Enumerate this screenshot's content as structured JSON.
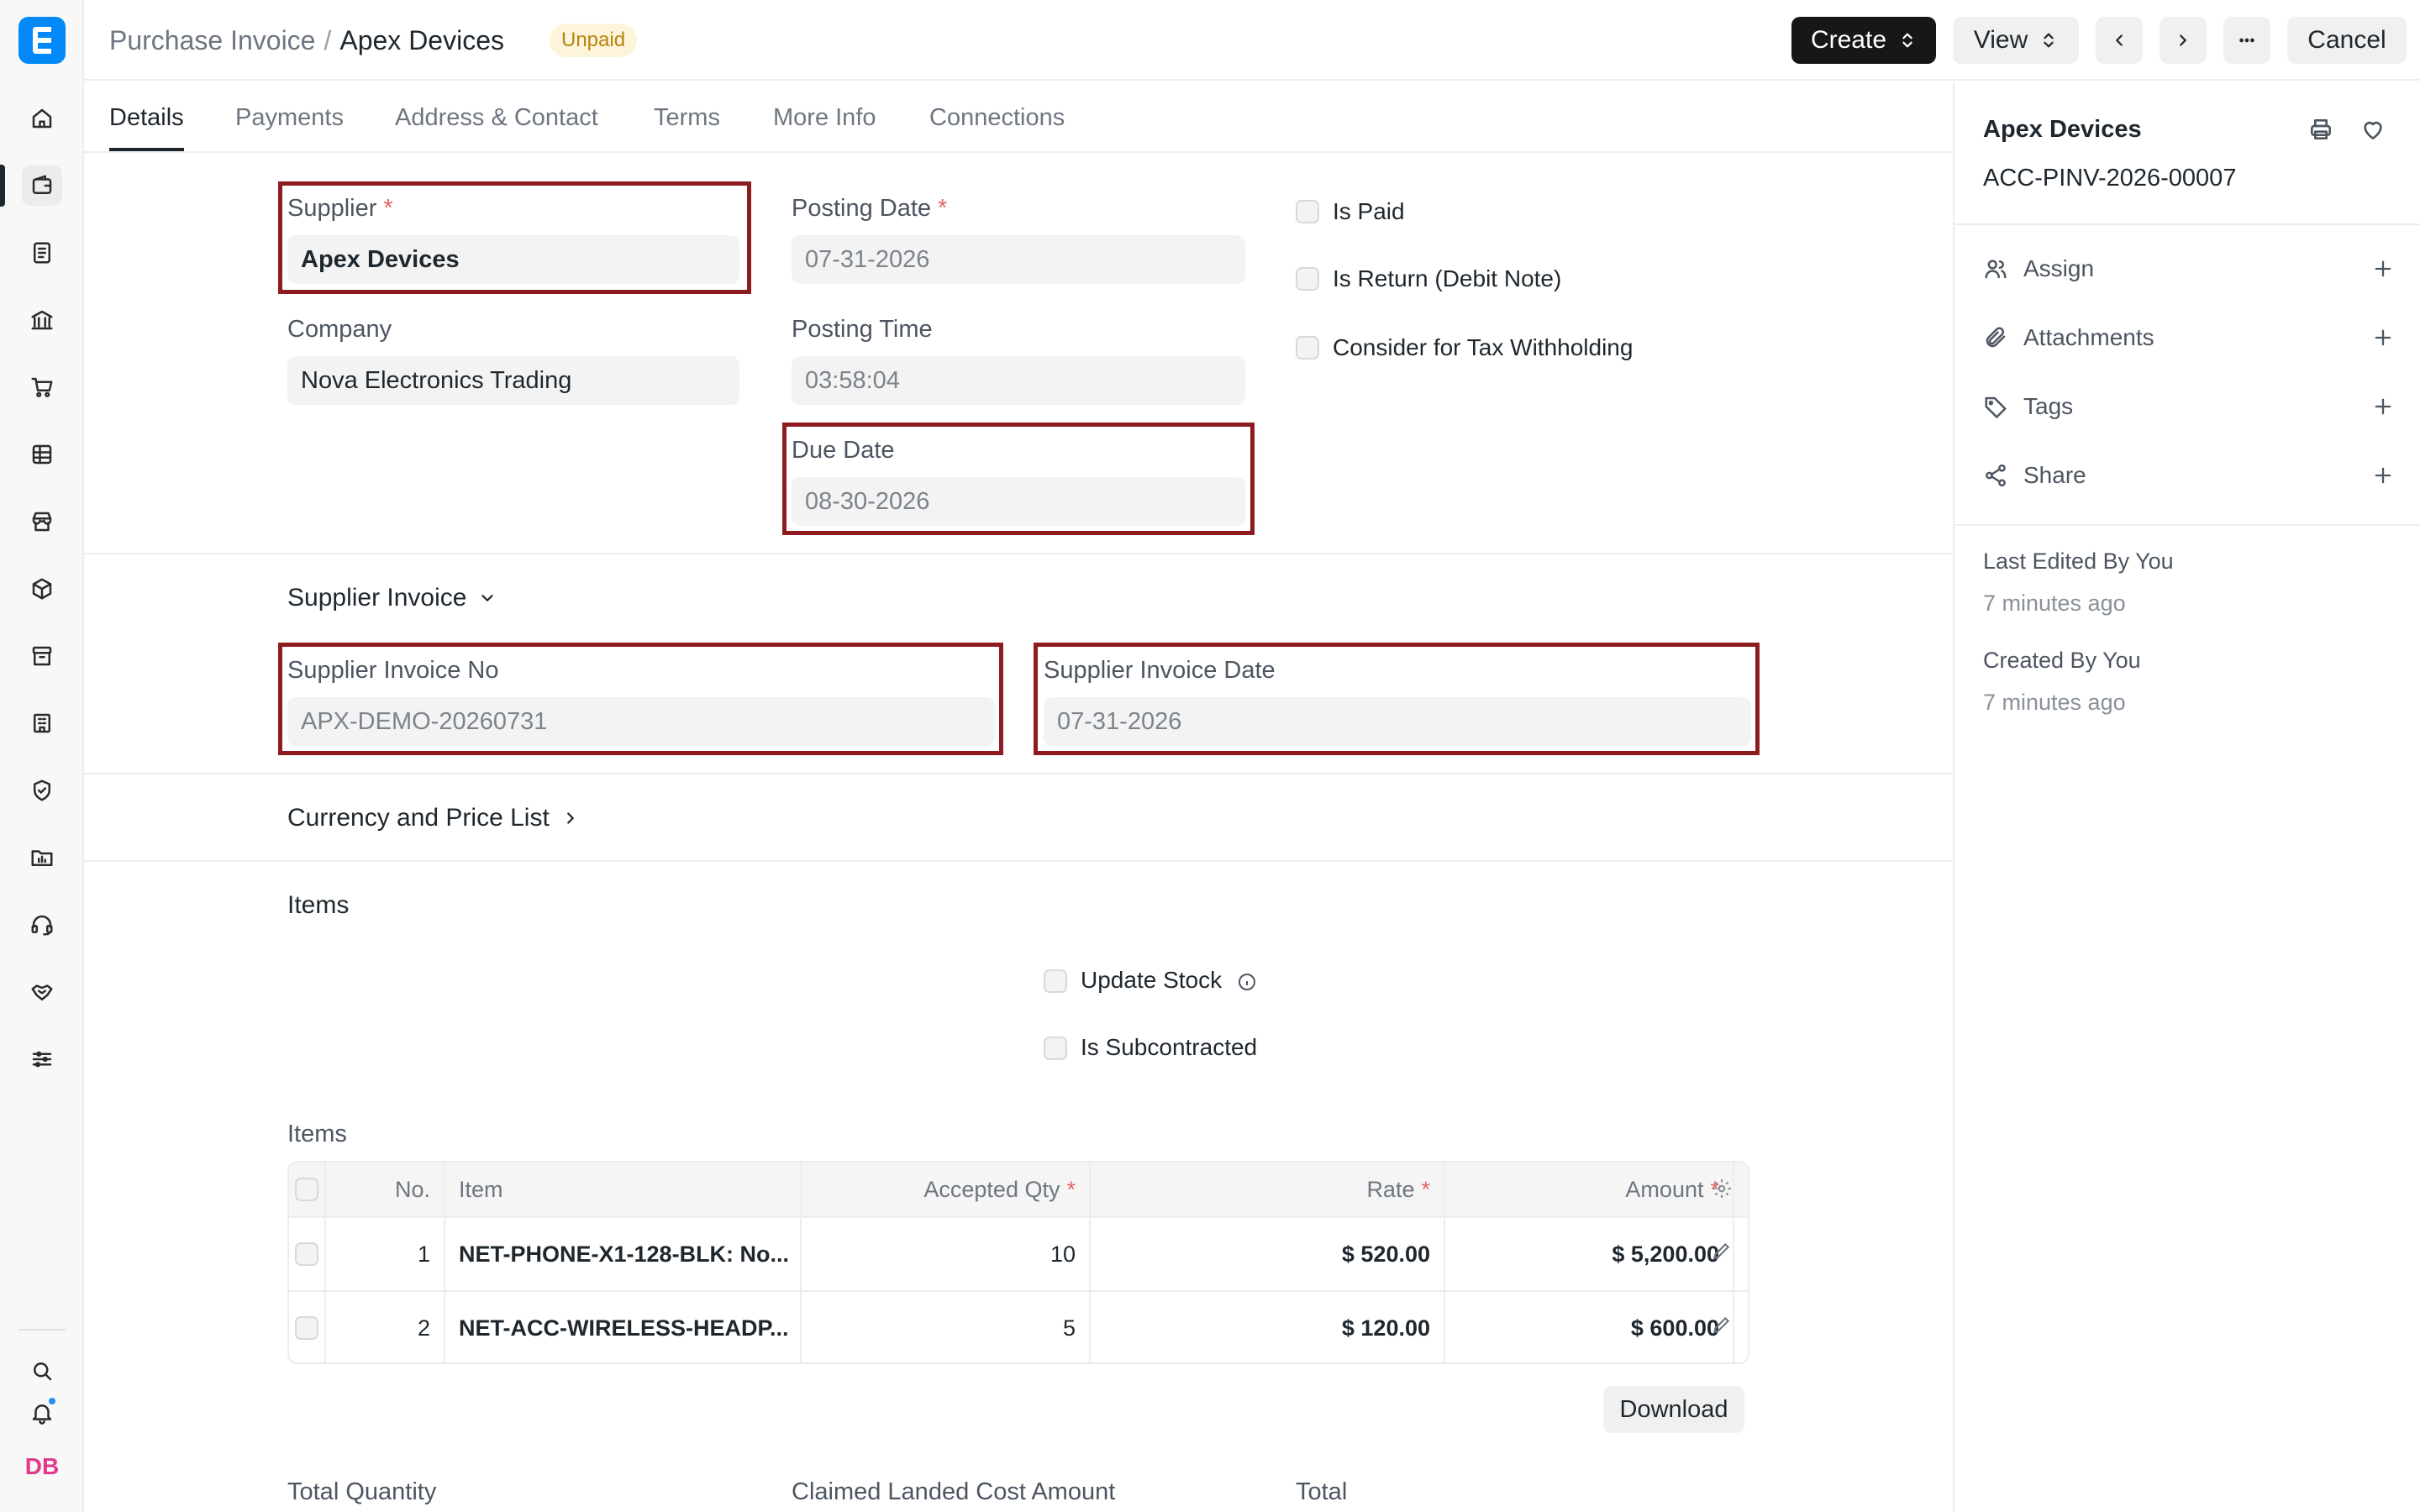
{
  "header": {
    "breadcrumb_parent": "Purchase Invoice",
    "breadcrumb_separator": "/",
    "breadcrumb_current": "Apex Devices",
    "status_badge": "Unpaid",
    "create_label": "Create",
    "view_label": "View",
    "cancel_label": "Cancel"
  },
  "tabs": [
    "Details",
    "Payments",
    "Address & Contact",
    "Terms",
    "More Info",
    "Connections"
  ],
  "form": {
    "supplier_label": "Supplier",
    "supplier_value": "Apex Devices",
    "company_label": "Company",
    "company_value": "Nova Electronics Trading",
    "posting_date_label": "Posting Date",
    "posting_date_value": "07-31-2026",
    "posting_time_label": "Posting Time",
    "posting_time_value": "03:58:04",
    "due_date_label": "Due Date",
    "due_date_value": "08-30-2026",
    "required_mark": "*",
    "checks": {
      "is_paid": "Is Paid",
      "is_return": "Is Return (Debit Note)",
      "tax_withholding": "Consider for Tax Withholding"
    }
  },
  "supplier_invoice": {
    "section_title": "Supplier Invoice",
    "no_label": "Supplier Invoice No",
    "no_value": "APX-DEMO-20260731",
    "date_label": "Supplier Invoice Date",
    "date_value": "07-31-2026"
  },
  "currency_section": "Currency and Price List",
  "items_section": {
    "title": "Items",
    "update_stock": "Update Stock",
    "is_subcontracted": "Is Subcontracted",
    "table_label": "Items",
    "columns": [
      "No.",
      "Item",
      "Accepted Qty",
      "Rate",
      "Amount"
    ],
    "rows": [
      {
        "no": "1",
        "item": "NET-PHONE-X1-128-BLK: No...",
        "qty": "10",
        "rate": "$ 520.00",
        "amount": "$ 5,200.00"
      },
      {
        "no": "2",
        "item": "NET-ACC-WIRELESS-HEADP...",
        "qty": "5",
        "rate": "$ 120.00",
        "amount": "$ 600.00"
      }
    ],
    "download_label": "Download"
  },
  "totals": {
    "total_quantity_label": "Total Quantity",
    "claimed_landed_label": "Claimed Landed Cost Amount",
    "total_label": "Total"
  },
  "sidebar": {
    "title": "Apex Devices",
    "doc_id": "ACC-PINV-2026-00007",
    "actions": [
      "Assign",
      "Attachments",
      "Tags",
      "Share"
    ],
    "last_edited": "Last Edited By You",
    "last_edited_time": "7 minutes ago",
    "created": "Created By You",
    "created_time": "7 minutes ago"
  },
  "user": {
    "initials": "DB"
  },
  "colors": {
    "highlight": "#8e1b1f",
    "brand": "#0289f7",
    "badge_bg": "#fdf4dc",
    "badge_text": "#b8850b"
  }
}
